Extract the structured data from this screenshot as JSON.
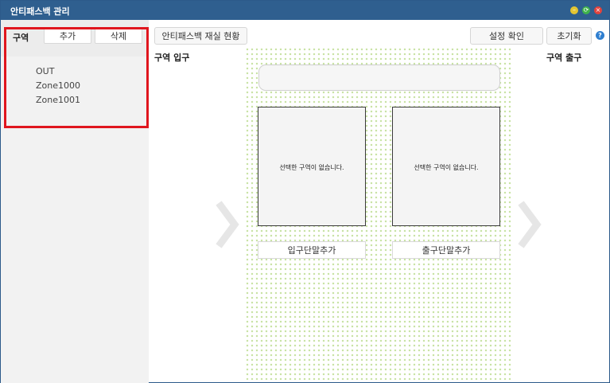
{
  "window": {
    "title": "안티패스백 관리",
    "buttons": {
      "minimize": "–",
      "maximize": "⟳",
      "close": "×"
    }
  },
  "sidebar": {
    "title": "구역",
    "add_label": "추가",
    "delete_label": "삭제",
    "zones": [
      "OUT",
      "Zone1000",
      "Zone1001"
    ]
  },
  "toolbar": {
    "status_label": "안티패스백 재실 현황",
    "confirm_label": "설정 확인",
    "reset_label": "초기화",
    "help": "?"
  },
  "main": {
    "zone_entry_label": "구역 입구",
    "zone_exit_label": "구역 출구",
    "entry_panel_text": "선택한 구역이 없습니다.",
    "exit_panel_text": "선택한 구역이 없습니다.",
    "add_entry_terminal": "입구단말추가",
    "add_exit_terminal": "출구단말추가"
  },
  "colors": {
    "titlebar": "#2f5f8f",
    "highlight": "#e0161e",
    "dots": "#c9e3a6"
  }
}
